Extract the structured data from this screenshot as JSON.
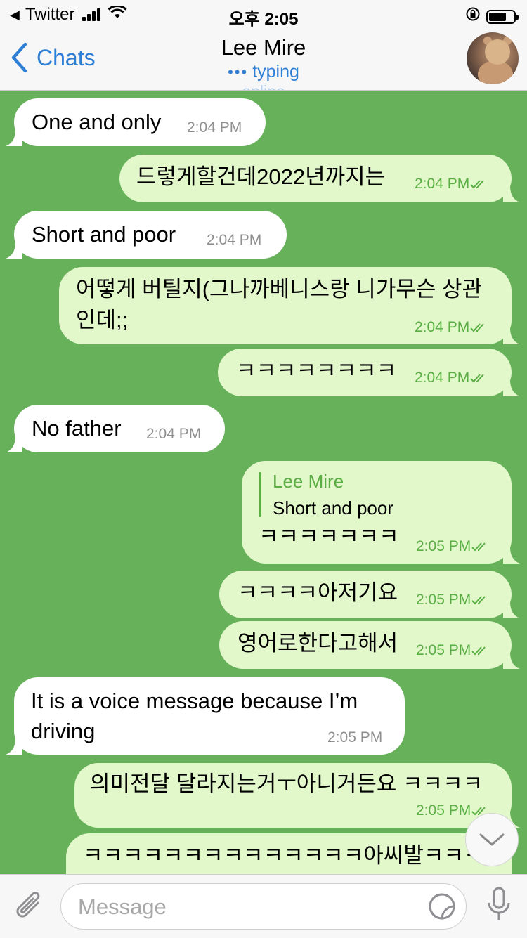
{
  "status_bar": {
    "back_app": "Twitter",
    "time": "오후 2:05"
  },
  "header": {
    "back_label": "Chats",
    "title": "Lee Mire",
    "status_typing": "typing",
    "status_online": "online"
  },
  "messages": [
    {
      "dir": "in",
      "text": "One and only",
      "time": "2:04 PM"
    },
    {
      "dir": "out",
      "text": "드렇게할건데2022년까지는",
      "time": "2:04 PM"
    },
    {
      "dir": "in",
      "text": "Short and poor",
      "time": "2:04 PM"
    },
    {
      "dir": "out",
      "text": "어떻게 버틸지(그나까베니스랑 니가무슨 상관",
      "text2": "인데;;",
      "time": "2:04 PM"
    },
    {
      "dir": "out",
      "text": "ㅋㅋㅋㅋㅋㅋㅋㅋ",
      "time": "2:04 PM"
    },
    {
      "dir": "in",
      "text": "No father",
      "time": "2:04 PM"
    },
    {
      "dir": "out",
      "reply_name": "Lee Mire",
      "reply_text": "Short and poor",
      "text": "ㅋㅋㅋㅋㅋㅋㅋ",
      "time": "2:05 PM"
    },
    {
      "dir": "out",
      "text": "ㅋㅋㅋㅋ아저기요",
      "time": "2:05 PM"
    },
    {
      "dir": "out",
      "text": "영어로한다고해서",
      "time": "2:05 PM"
    },
    {
      "dir": "in",
      "text": "It is a voice message because I’m",
      "text2": "driving",
      "time": "2:05 PM"
    },
    {
      "dir": "out",
      "text": "의미전달 달라지는거ㅜ아니거든요 ㅋㅋㅋㅋ",
      "time": "2:05 PM"
    },
    {
      "dir": "out",
      "text": "ㅋㅋㅋㅋㅋㅋㅋㅋㅋㅋㅋㅋㅋㅋ아씨발ㅋㅋㅋ",
      "time": ""
    }
  ],
  "input": {
    "placeholder": "Message"
  },
  "colors": {
    "chat_background": "#67b15a",
    "outgoing_bubble": "#e2f8cb",
    "incoming_bubble": "#ffffff",
    "accent_blue": "#2e7fd6",
    "outgoing_meta": "#5aae43"
  },
  "icons": [
    "chevron-left-icon",
    "wifi-icon",
    "signal-icon",
    "battery-icon",
    "orientation-lock-icon",
    "checkmarks-icon",
    "chevron-down-icon",
    "paperclip-icon",
    "sticker-icon",
    "microphone-icon"
  ]
}
